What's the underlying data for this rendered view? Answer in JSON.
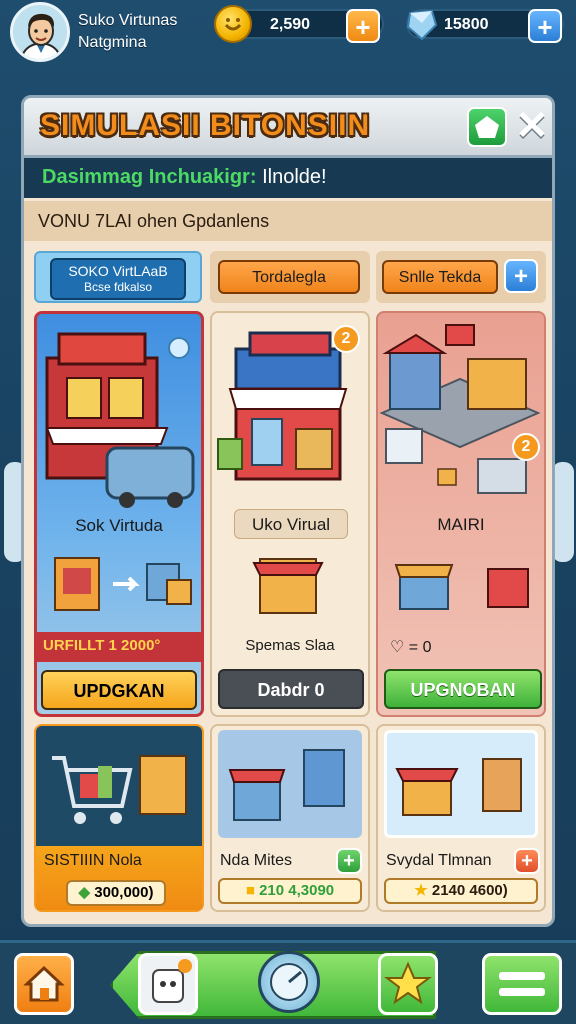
{
  "player": {
    "name_line1": "Suko Virtunas",
    "name_line2": "Natgmina"
  },
  "currency": {
    "coins": {
      "value": "2,590"
    },
    "gems": {
      "value": "15800"
    },
    "add_label": "+"
  },
  "panel": {
    "title": "SIMULASII BITONSIIN",
    "close_label": "✕",
    "subtitle_prefix": "Dasimmag Inchuakigr:",
    "subtitle_value": "Ilnolde!",
    "info_text": "VONU 7LAI ohen Gpdanlens"
  },
  "columns": {
    "col1": {
      "label_line1": "SOKO VirtLAaB",
      "label_line2": "Bcse fdkalso"
    },
    "col2": {
      "label": "Tordalegla"
    },
    "col3": {
      "label": "Snlle Tekda",
      "add_label": "+"
    }
  },
  "cards": {
    "card1": {
      "title": "Sok Virtuda",
      "price": "URFILLT 1 2000°",
      "button": "UPDGKAN",
      "badge": ""
    },
    "card2": {
      "title": "Uko Virual",
      "subtitle": "Spemas Slaa",
      "button": "Dabdr 0",
      "badge": "2"
    },
    "card3": {
      "title": "MAIRI",
      "heart_value": "= 0",
      "button": "UPGNOBAN",
      "badge": "2"
    },
    "card4": {
      "title": "SISTIIIN Nola",
      "price": "300,000)"
    },
    "card5": {
      "title": "Nda Mites",
      "price": "210 4,3090",
      "add_label": "+"
    },
    "card6": {
      "title": "Svydal Tlmnan",
      "price": "2140 4600)",
      "add_label": "+"
    }
  },
  "colors": {
    "accent_orange": "#f28c1b",
    "accent_green": "#4cd964",
    "panel_bg": "#f4e6d2",
    "dark_bar": "#173a52"
  },
  "icons": [
    "home-icon",
    "pet-icon",
    "compass-icon",
    "star-icon",
    "menu-icon",
    "coin-icon",
    "gem-icon",
    "close-icon"
  ]
}
